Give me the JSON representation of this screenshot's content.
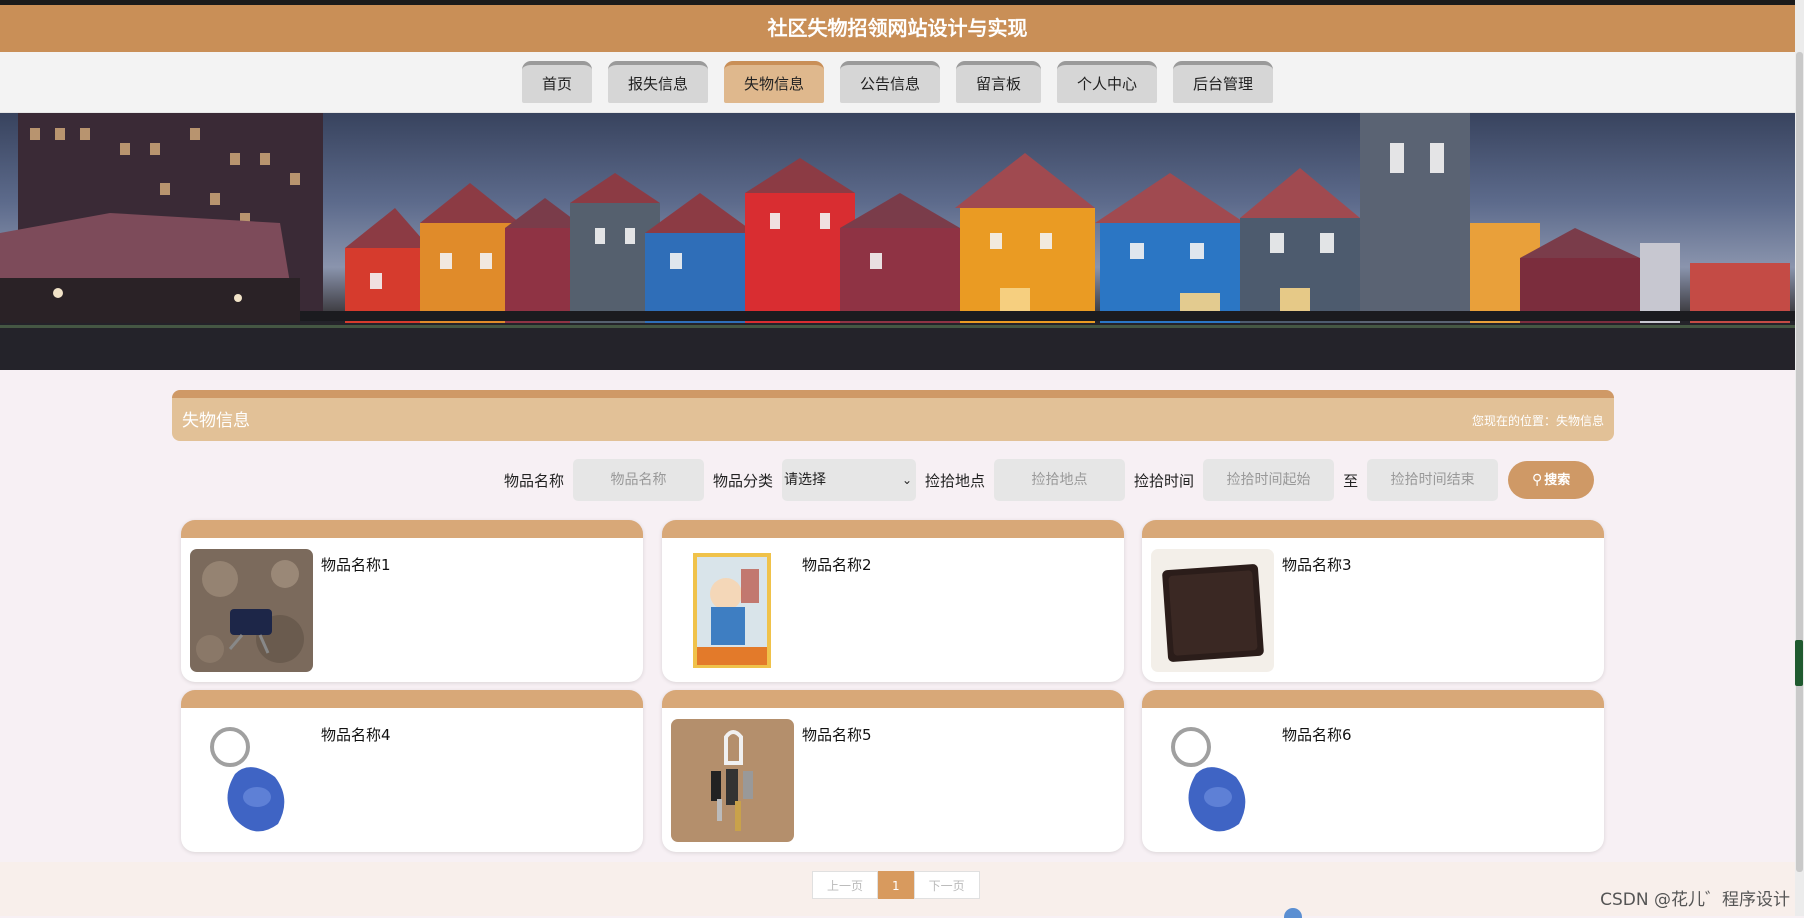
{
  "site_title": "社区失物招领网站设计与实现",
  "nav": {
    "items": [
      {
        "label": "首页",
        "active": false
      },
      {
        "label": "报失信息",
        "active": false
      },
      {
        "label": "失物信息",
        "active": true
      },
      {
        "label": "公告信息",
        "active": false
      },
      {
        "label": "留言板",
        "active": false
      },
      {
        "label": "个人中心",
        "active": false
      },
      {
        "label": "后台管理",
        "active": false
      }
    ]
  },
  "section": {
    "title": "失物信息",
    "location_prefix": "您现在的位置：",
    "location_value": "失物信息"
  },
  "search": {
    "name_label": "物品名称",
    "name_placeholder": "物品名称",
    "category_label": "物品分类",
    "category_value": "请选择",
    "place_label": "捡拾地点",
    "place_placeholder": "捡拾地点",
    "time_label": "捡拾时间",
    "time_start_placeholder": "捡拾时间起始",
    "to_label": "至",
    "time_end_placeholder": "捡拾时间结束",
    "button_label": "搜索"
  },
  "items": [
    {
      "name": "物品名称1",
      "image": "keys-on-ground-image"
    },
    {
      "name": "物品名称2",
      "image": "book-cover-image"
    },
    {
      "name": "物品名称3",
      "image": "wallet-image"
    },
    {
      "name": "物品名称4",
      "image": "blue-keyfob-image"
    },
    {
      "name": "物品名称5",
      "image": "keychain-image"
    },
    {
      "name": "物品名称6",
      "image": "blue-keyfob-image"
    }
  ],
  "pager": {
    "prev": "上一页",
    "current": "1",
    "next": "下一页"
  },
  "watermark": "CSDN @花儿゛程序设计",
  "colors": {
    "accent": "#c98f57",
    "nav_active": "#dfb88d",
    "card_header": "#d8a878"
  }
}
